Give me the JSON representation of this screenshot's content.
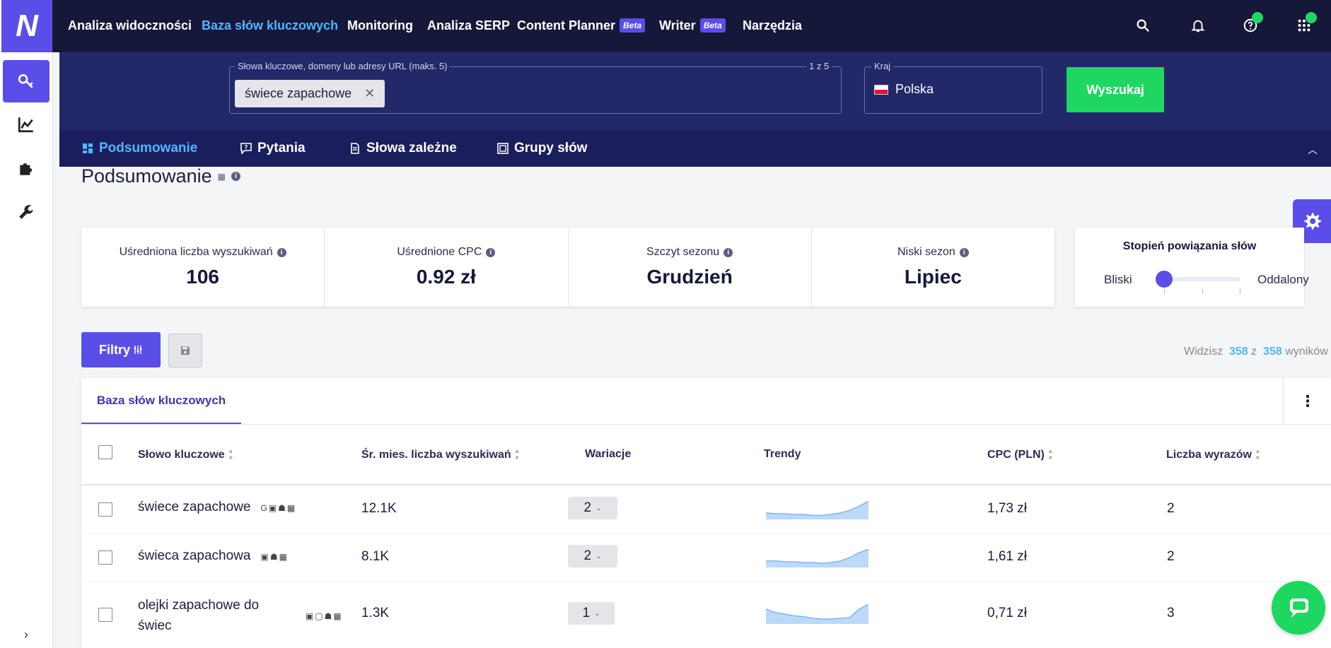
{
  "logo": {
    "letter": "N"
  },
  "nav": {
    "items": [
      {
        "label": "Analiza widoczności"
      },
      {
        "label": "Baza słów kluczowych"
      },
      {
        "label": "Monitoring"
      },
      {
        "label": "Analiza SERP"
      },
      {
        "label": "Content Planner",
        "badge": "Beta"
      },
      {
        "label": "Writer",
        "badge": "Beta"
      },
      {
        "label": "Narzędzia"
      }
    ],
    "icons": [
      "search-icon",
      "bell-icon",
      "help-icon",
      "apps-grid-icon"
    ]
  },
  "search": {
    "keywords_label": "Słowa kluczowe, domeny lub adresy URL (maks. 5)",
    "keywords_count": "1 z 5",
    "chip": "świece zapachowe",
    "country_label": "Kraj",
    "country": "Polska",
    "button": "Wyszukaj"
  },
  "subtabs": [
    {
      "label": "Podsumowanie"
    },
    {
      "label": "Pytania"
    },
    {
      "label": "Słowa zależne"
    },
    {
      "label": "Grupy słów"
    }
  ],
  "page": {
    "title": "Podsumowanie"
  },
  "stats": [
    {
      "label": "Uśredniona liczba wyszukiwań",
      "value": "106"
    },
    {
      "label": "Uśrednione CPC",
      "value": "0.92 zł"
    },
    {
      "label": "Szczyt sezonu",
      "value": "Grudzień"
    },
    {
      "label": "Niski sezon",
      "value": "Lipiec"
    }
  ],
  "relation": {
    "title": "Stopień powiązania słów",
    "near": "Bliski",
    "far": "Oddalony",
    "level": 0
  },
  "filters": {
    "button": "Filtry"
  },
  "results": {
    "prefix": "Widzisz",
    "shown": "358",
    "mid": "z",
    "total": "358",
    "suffix": "wyników"
  },
  "table": {
    "tab": "Baza słów kluczowych",
    "columns": [
      "Słowo kluczowe",
      "Śr. mies. liczba wyszukiwań",
      "Wariacje",
      "Trendy",
      "CPC (PLN)",
      "Liczba wyrazów"
    ],
    "rows": [
      {
        "keyword": "świece zapachowe",
        "icons": "G▣☗▦",
        "volume": "12.1K",
        "variations": "2",
        "cpc": "1,73 zł",
        "words": "2",
        "trend": [
          4,
          3.5,
          3.5,
          3,
          3,
          2.5,
          2.5,
          3,
          4,
          5.5,
          8,
          11
        ]
      },
      {
        "keyword": "świeca zapachowa",
        "icons": "▣☗▦",
        "volume": "8.1K",
        "variations": "2",
        "cpc": "1,61 zł",
        "words": "2",
        "trend": [
          4,
          4,
          3.5,
          3.5,
          3,
          3,
          2.5,
          3,
          4,
          6,
          9,
          11
        ]
      },
      {
        "keyword_line1": "olejki zapachowe do",
        "keyword_line2": "świec",
        "icons": "▣▢☗▦",
        "volume": "1.3K",
        "variations": "1",
        "cpc": "0,71 zł",
        "words": "3",
        "trend": [
          9,
          7,
          6,
          5,
          4.5,
          3.5,
          3,
          3,
          3.5,
          4,
          9,
          12
        ]
      }
    ]
  },
  "colors": {
    "accent": "#5b4ee8",
    "nav_bg": "#16183a",
    "link": "#4fb6ff",
    "green": "#1ed760"
  }
}
